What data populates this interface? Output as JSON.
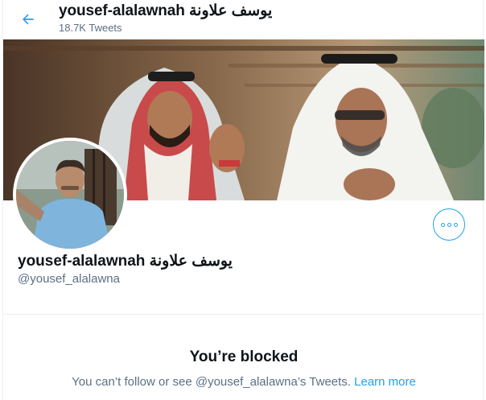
{
  "header": {
    "title": "yousef-alalawnah يوسف علاونة",
    "tweet_count": "18.7K Tweets",
    "back_icon": "arrow-left-icon"
  },
  "profile": {
    "display_name": "yousef-alalawnah يوسف علاونة",
    "handle": "@yousef_alalawna",
    "more_icon": "ellipsis-icon"
  },
  "blocked": {
    "title": "You’re blocked",
    "message": "You can’t follow or see @yousef_alalawna’s Tweets.",
    "learn_more": "Learn more"
  },
  "colors": {
    "accent": "#1da1f2",
    "secondary_text": "#5b7083",
    "primary_text": "#0f1419",
    "border": "#ebeef0"
  }
}
